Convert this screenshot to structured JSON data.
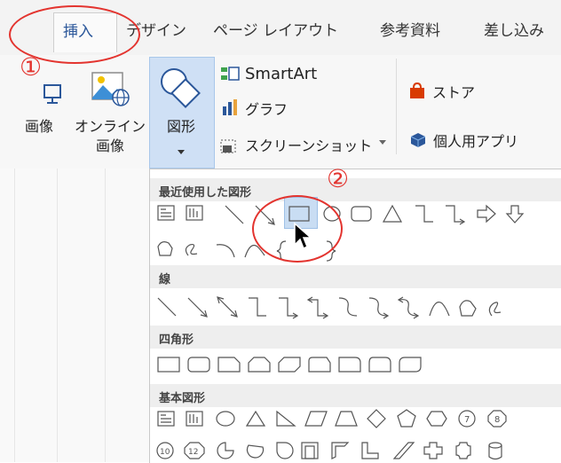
{
  "ribbon_tabs": {
    "insert": "挿入",
    "design": "デザイン",
    "layout": "ページ レイアウト",
    "references": "参考資料",
    "mailings": "差し込み"
  },
  "buttons": {
    "picture_partial": "画像",
    "online_picture": [
      "オンライン",
      "画像"
    ],
    "shapes": "図形",
    "smartart": "SmartArt",
    "chart": "グラフ",
    "screenshot": "スクリーンショット",
    "store": "ストア",
    "my_apps": "個人用アプリ"
  },
  "gallery": {
    "recent": "最近使用した図形",
    "lines": "線",
    "rectangles": "四角形",
    "basic": "基本図形"
  },
  "annotations": {
    "step1": "①",
    "step2": "②"
  },
  "colors": {
    "accent": "#2b579a",
    "highlight": "#cfe0f5",
    "annotation": "#e3342f"
  }
}
